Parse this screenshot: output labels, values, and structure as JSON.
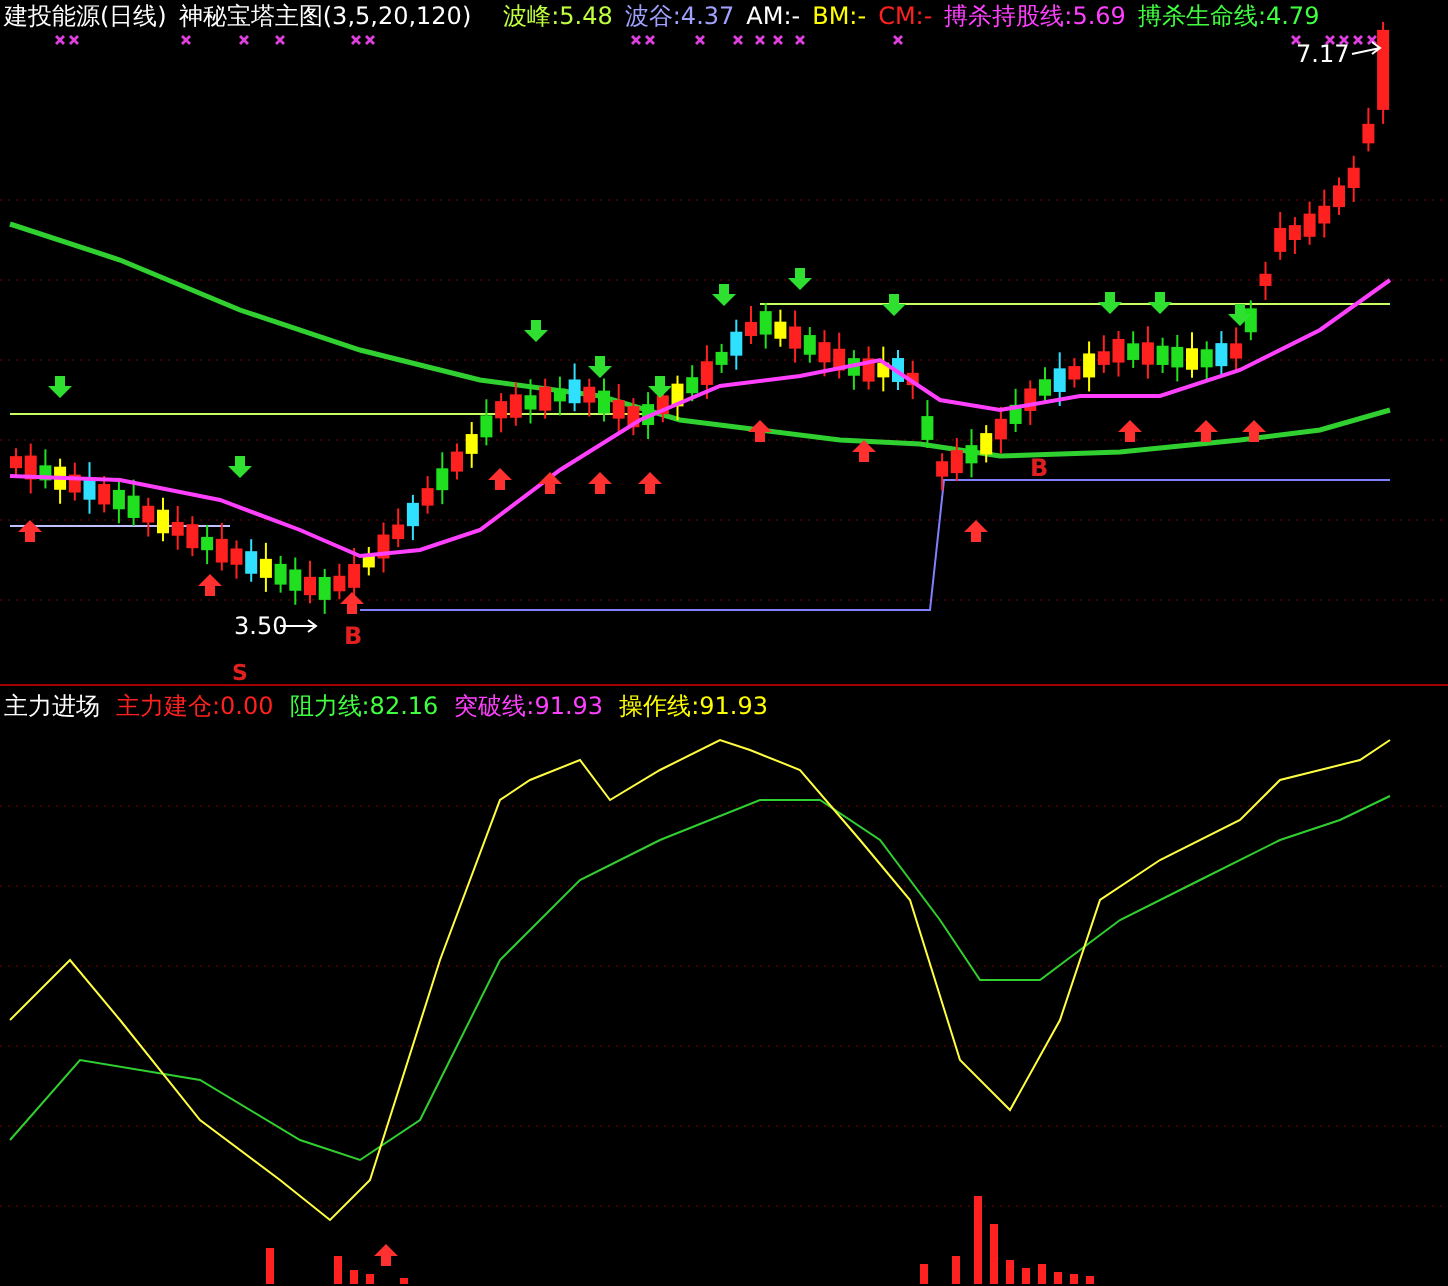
{
  "main_chart": {
    "legend": [
      {
        "text": "建投能源(日线)",
        "color": "#ffffff"
      },
      {
        "text": "神秘宝塔主图(3,5,20,120)",
        "color": "#ffffff"
      },
      {
        "text": "波峰:5.48",
        "color": "#c0ff40"
      },
      {
        "text": "波谷:4.37",
        "color": "#a0a0ff"
      },
      {
        "text": "AM:-",
        "color": "#ffffff"
      },
      {
        "text": "BM:-",
        "color": "#ffff00"
      },
      {
        "text": "CM:-",
        "color": "#ff2020"
      },
      {
        "text": "搏杀持股线:5.69",
        "color": "#ff40ff"
      },
      {
        "text": "搏杀生命线:4.79",
        "color": "#40ff40"
      }
    ],
    "high_label": "7.17",
    "low_label": "3.50",
    "buy_signals": [
      "B",
      "B"
    ],
    "sell_signal": "S"
  },
  "indicator_chart": {
    "legend": [
      {
        "text": "主力进场",
        "color": "#ffffff"
      },
      {
        "text": "主力建仓:0.00",
        "color": "#ff2020"
      },
      {
        "text": "阻力线:82.16",
        "color": "#40ff40"
      },
      {
        "text": "突破线:91.93",
        "color": "#ff40ff"
      },
      {
        "text": "操作线:91.93",
        "color": "#ffff00"
      }
    ]
  }
}
